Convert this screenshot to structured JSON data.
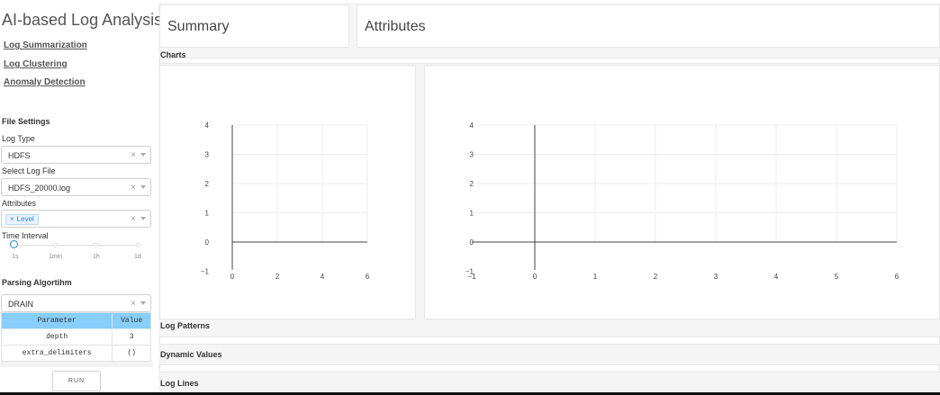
{
  "accent_color": "#1e88e5",
  "table_header_color": "#87cefa",
  "sidebar": {
    "title": "AI-based Log Analysis",
    "nav": [
      {
        "label": "Log Summarization"
      },
      {
        "label": "Log Clustering"
      },
      {
        "label": "Anomaly Detection"
      }
    ],
    "file_settings_title": "File Settings",
    "log_type": {
      "label": "Log Type",
      "value": "HDFS"
    },
    "log_file": {
      "label": "Select Log File",
      "value": "HDFS_20000.log"
    },
    "attributes": {
      "label": "Attributes",
      "chip": "Level"
    },
    "time_interval": {
      "label": "Time Interval",
      "marks": [
        "1s",
        "1min",
        "1h",
        "1d"
      ],
      "selected": "1s"
    },
    "parsing_title": "Parsing Algortihm",
    "parsing_algorithm": {
      "value": "DRAIN"
    },
    "param_table": {
      "headers": [
        "Parameter",
        "Value"
      ],
      "rows": [
        [
          "depth",
          "3"
        ],
        [
          "extra_delimiters",
          "()"
        ]
      ]
    },
    "run_label": "RUN"
  },
  "main": {
    "summary_title": "Summary",
    "attributes_title": "Attributes",
    "charts_label": "Charts",
    "log_patterns_label": "Log Patterns",
    "dynamic_values_label": "Dynamic Values",
    "log_lines_label": "Log Lines"
  },
  "chart_data": [
    {
      "type": "line",
      "series": [],
      "x_ticks": [
        "0",
        "2",
        "4",
        "6"
      ],
      "y_ticks": [
        "−1",
        "0",
        "1",
        "2",
        "3",
        "4"
      ],
      "xlim": [
        -1,
        6
      ],
      "ylim": [
        -1,
        4
      ],
      "grid": true
    },
    {
      "type": "line",
      "series": [],
      "x_ticks": [
        "−1",
        "0",
        "1",
        "2",
        "3",
        "4",
        "5",
        "6"
      ],
      "y_ticks": [
        "−1",
        "0",
        "1",
        "2",
        "3",
        "4"
      ],
      "xlim": [
        -1,
        6
      ],
      "ylim": [
        -1,
        4
      ],
      "grid": true
    }
  ]
}
